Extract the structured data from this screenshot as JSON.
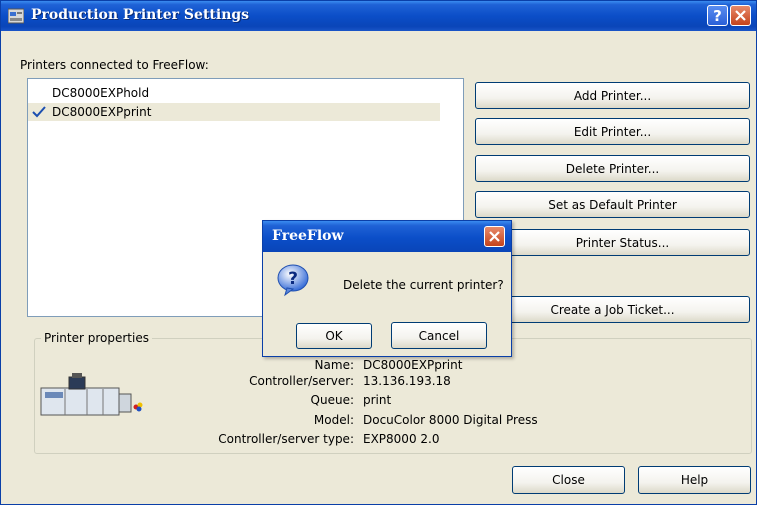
{
  "window": {
    "title": "Production Printer Settings"
  },
  "printers": {
    "label": "Printers connected to FreeFlow:",
    "items": [
      {
        "name": "DC8000EXPhold",
        "default": false
      },
      {
        "name": "DC8000EXPprint",
        "default": true
      }
    ]
  },
  "buttons": {
    "add": "Add Printer...",
    "edit": "Edit Printer...",
    "delete": "Delete Printer...",
    "set_default": "Set as Default Printer",
    "status": "Printer Status...",
    "job_ticket": "Create a Job Ticket...",
    "close": "Close",
    "help": "Help"
  },
  "properties": {
    "legend": "Printer properties",
    "name_label": "Name:",
    "name_value": "DC8000EXPprint",
    "server_label": "Controller/server:",
    "server_value": "13.136.193.18",
    "queue_label": "Queue:",
    "queue_value": "print",
    "model_label": "Model:",
    "model_value": "DocuColor 8000 Digital Press",
    "type_label": "Controller/server type:",
    "type_value": "EXP8000 2.0"
  },
  "dialog": {
    "title": "FreeFlow",
    "message": "Delete the current printer?",
    "ok": "OK",
    "cancel": "Cancel"
  },
  "colors": {
    "titlebar": "#0b4ec8",
    "window_bg": "#ece9d8",
    "check": "#1c4fb0"
  }
}
